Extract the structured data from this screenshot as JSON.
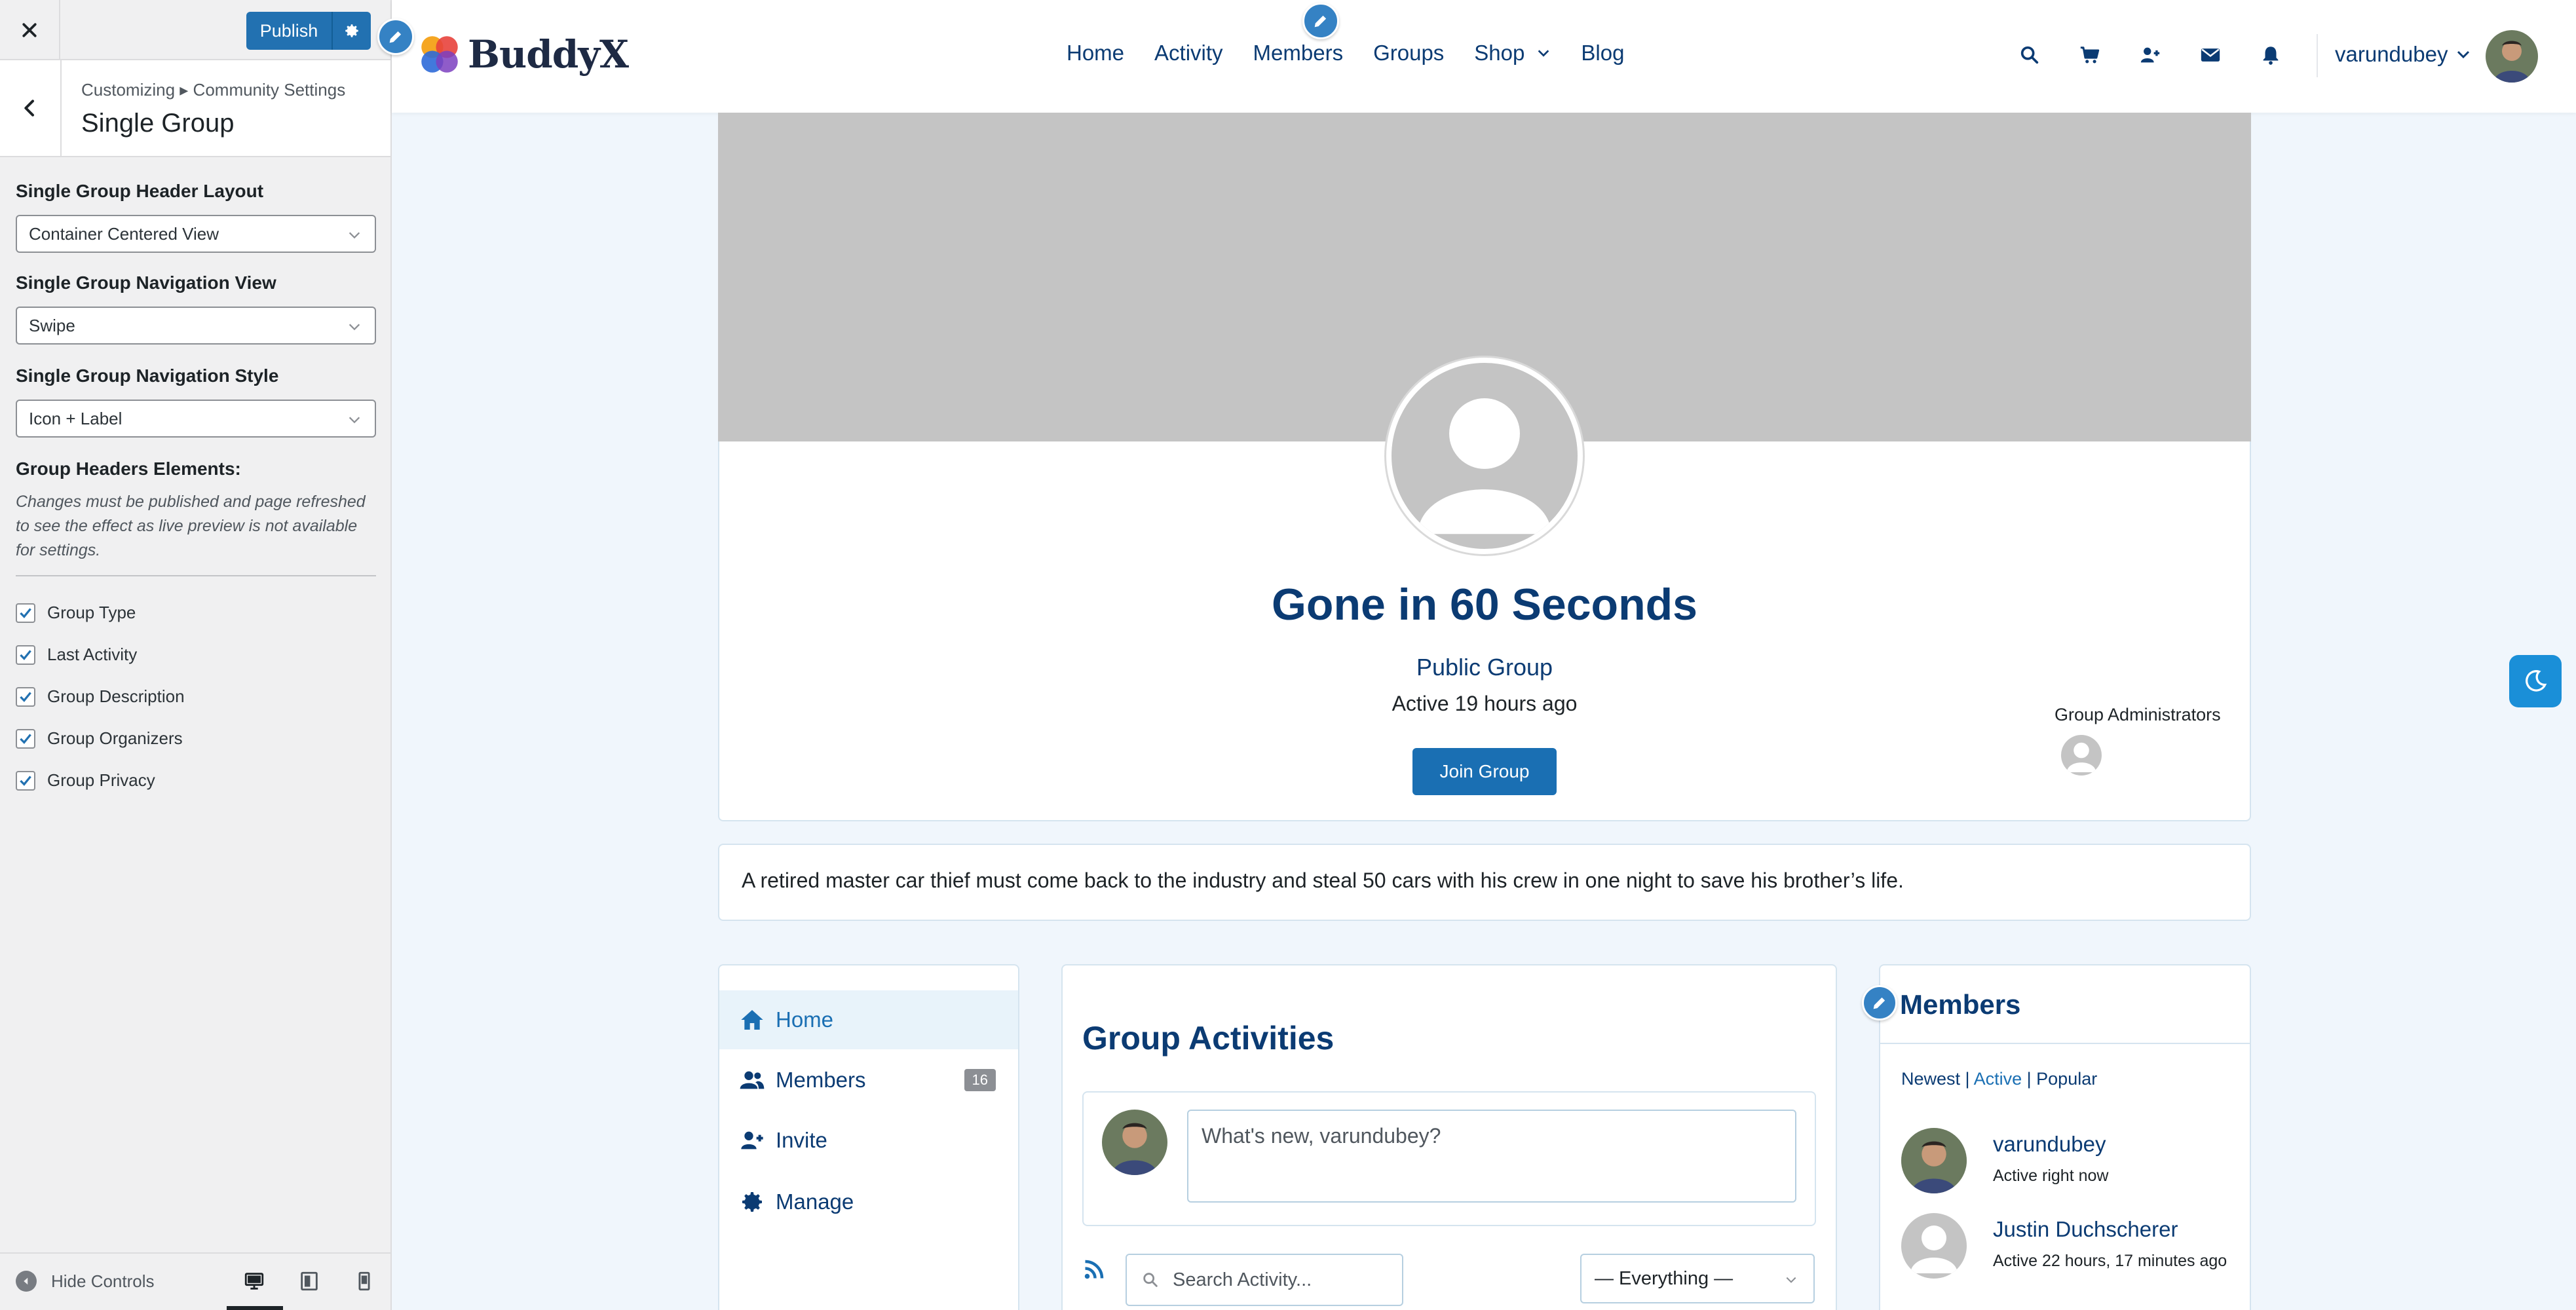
{
  "customizer": {
    "publish_label": "Publish",
    "breadcrumb": "Customizing ▸ Community Settings",
    "section_title": "Single Group",
    "fields": [
      {
        "label": "Single Group Header Layout",
        "value": "Container Centered View"
      },
      {
        "label": "Single Group Navigation View",
        "value": "Swipe"
      },
      {
        "label": "Single Group Navigation Style",
        "value": "Icon + Label"
      }
    ],
    "elements_heading": "Group Headers Elements:",
    "elements_note": "Changes must be published and page refreshed to see the effect as live preview is not available for settings.",
    "checkboxes": [
      {
        "label": "Group Type",
        "checked": true
      },
      {
        "label": "Last Activity",
        "checked": true
      },
      {
        "label": "Group Description",
        "checked": true
      },
      {
        "label": "Group Organizers",
        "checked": true
      },
      {
        "label": "Group Privacy",
        "checked": true
      }
    ],
    "hide_controls": "Hide Controls",
    "active_device": "desktop"
  },
  "site": {
    "logo_text": "BuddyX",
    "nav": [
      "Home",
      "Activity",
      "Members",
      "Groups",
      "Shop",
      "Blog"
    ],
    "header_icons": [
      "search-icon",
      "cart-icon",
      "user-plus-icon",
      "envelope-icon",
      "bell-icon"
    ],
    "username": "varundubey"
  },
  "group": {
    "title": "Gone in 60 Seconds",
    "type": "Public Group",
    "active": "Active 19 hours ago",
    "join_label": "Join Group",
    "admins_label": "Group Administrators",
    "description": "A retired master car thief must come back to the industry and steal 50 cars with his crew in one night to save his brother’s life."
  },
  "group_nav": [
    {
      "label": "Home",
      "icon": "home-icon",
      "active": true
    },
    {
      "label": "Members",
      "icon": "users-icon",
      "count": "16"
    },
    {
      "label": "Invite",
      "icon": "user-plus-icon"
    },
    {
      "label": "Manage",
      "icon": "gear-icon"
    }
  ],
  "activities": {
    "title": "Group Activities",
    "post_placeholder": "What's new, varundubey?",
    "search_placeholder": "Search Activity...",
    "filter_value": "— Everything —"
  },
  "members_widget": {
    "title": "Members",
    "filters": {
      "newest": "Newest",
      "active": "Active",
      "popular": "Popular",
      "sep": "|"
    },
    "members": [
      {
        "name": "varundubey",
        "status": "Active right now"
      },
      {
        "name": "Justin Duchscherer",
        "status": "Active 22 hours, 17 minutes ago"
      }
    ]
  },
  "colors": {
    "primary": "#0b3b73",
    "accent": "#1a6fb3",
    "wp_blue": "#2271b1",
    "cover": "#c4c4c4",
    "page_bg": "#f0f6fc"
  }
}
